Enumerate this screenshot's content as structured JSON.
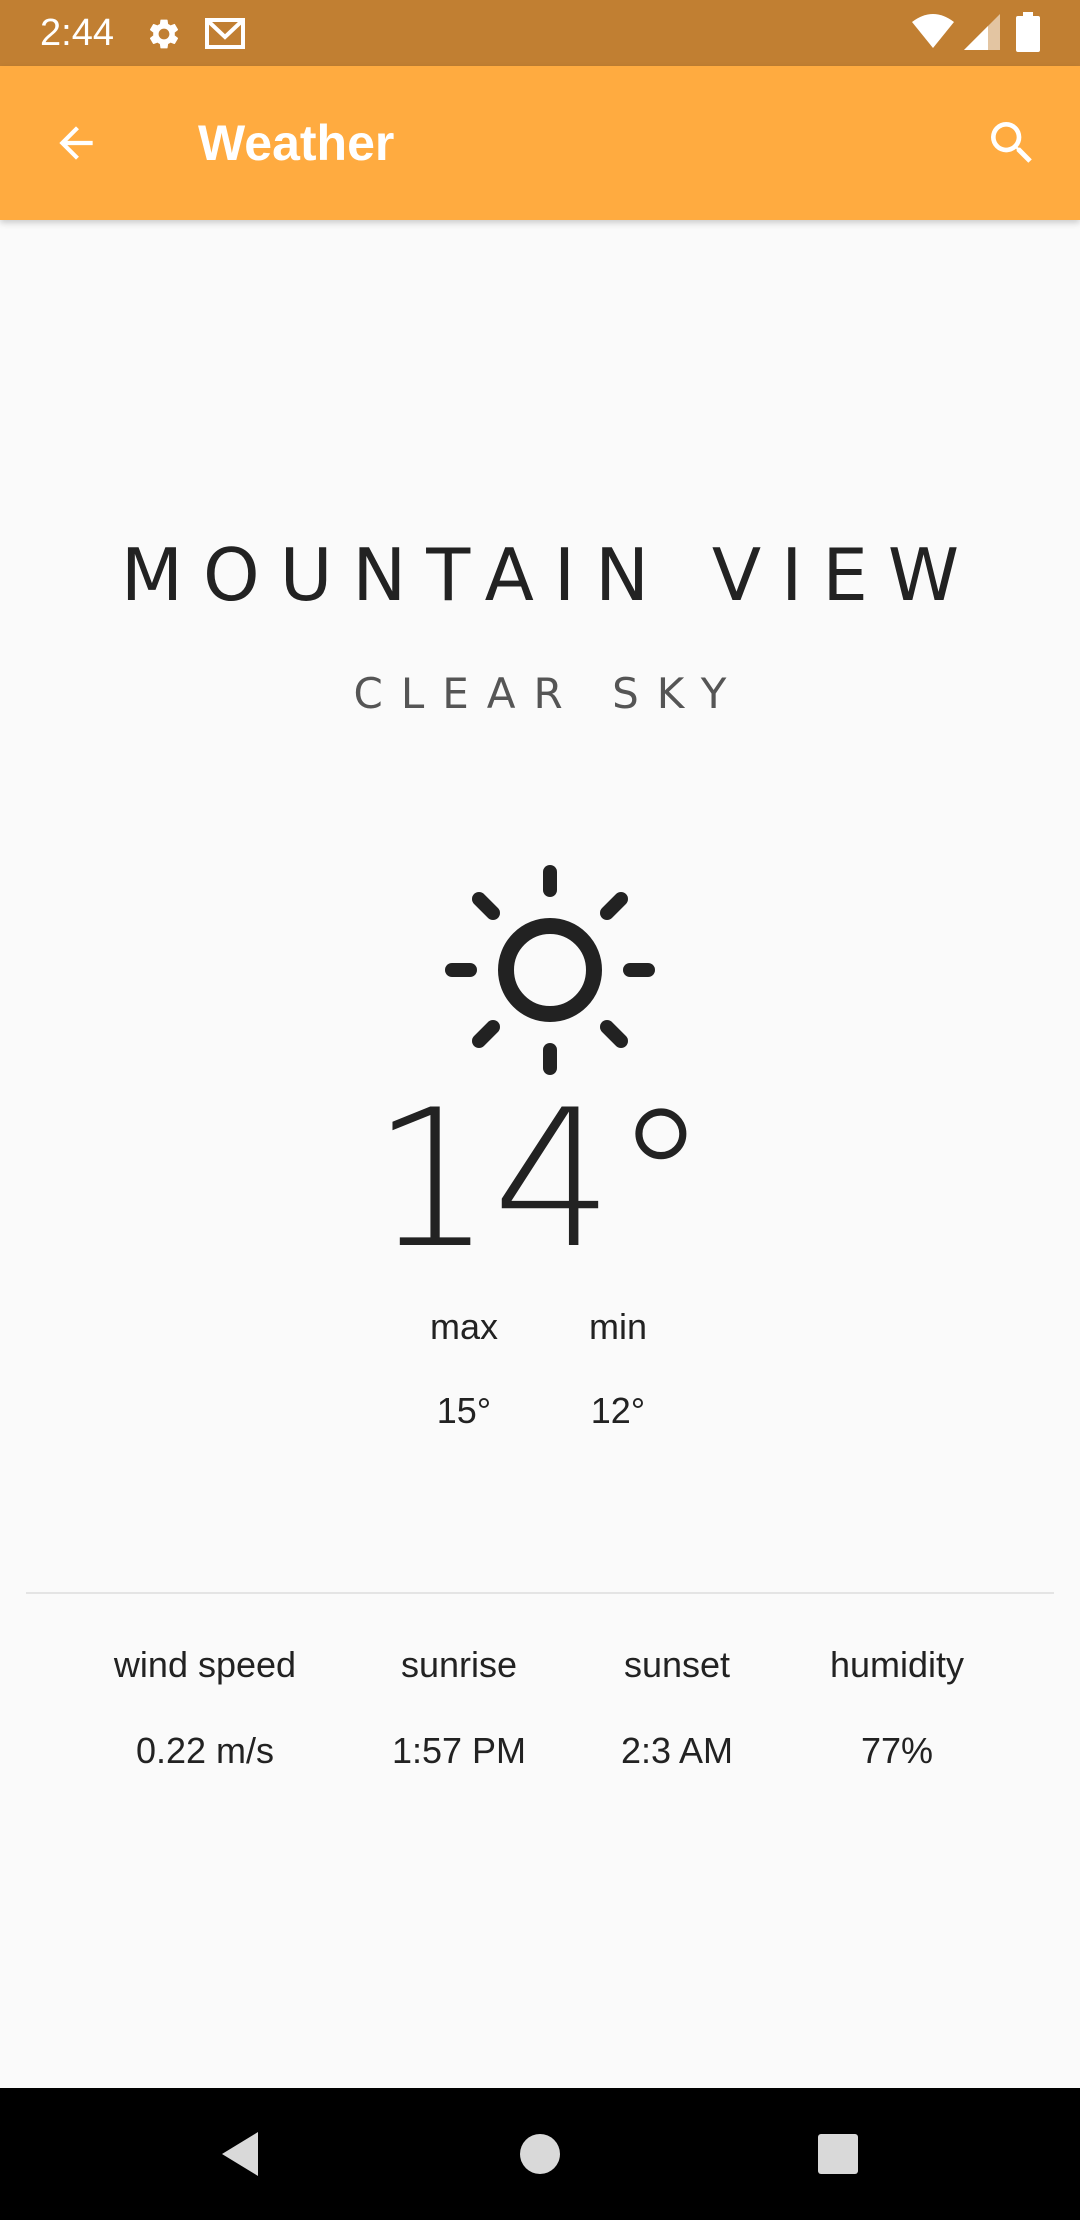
{
  "status_bar": {
    "time": "2:44",
    "icons": [
      "settings-icon",
      "gmail-icon",
      "wifi-icon",
      "signal-icon",
      "battery-icon"
    ],
    "background": "#c17f32"
  },
  "app_bar": {
    "title": "Weather",
    "back_icon": "arrow-back-icon",
    "search_icon": "search-icon",
    "background": "#ffab40"
  },
  "weather": {
    "city": "MOUNTAIN VIEW",
    "condition": "CLEAR SKY",
    "icon": "sun-icon",
    "temperature": "14°",
    "max_label": "max",
    "min_label": "min",
    "max_value": "15°",
    "min_value": "12°"
  },
  "details": [
    {
      "label": "wind speed",
      "value": "0.22 m/s"
    },
    {
      "label": "sunrise",
      "value": "1:57 PM"
    },
    {
      "label": "sunset",
      "value": "2:3 AM"
    },
    {
      "label": "humidity",
      "value": "77%"
    }
  ],
  "nav_bar": {
    "buttons": [
      "back-triangle-icon",
      "home-circle-icon",
      "recents-square-icon"
    ]
  }
}
